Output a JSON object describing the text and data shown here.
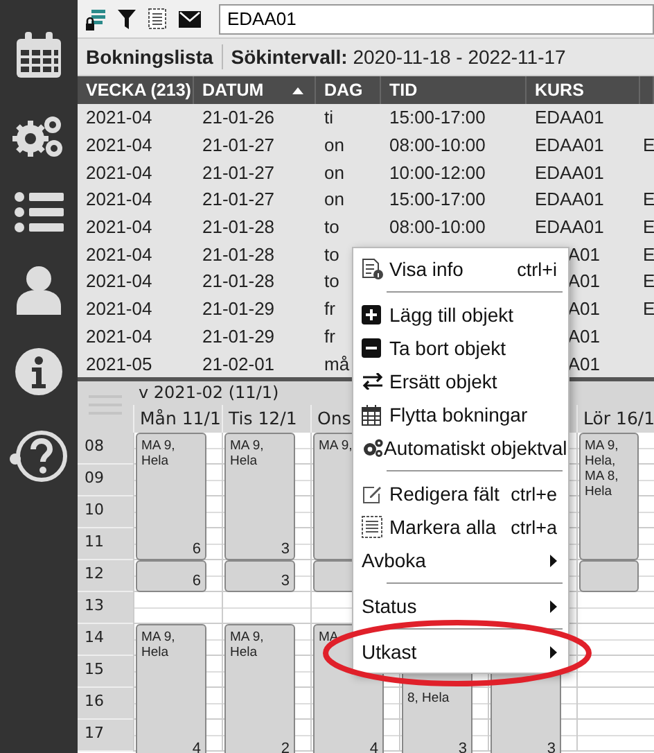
{
  "sidebar": {
    "items": [
      {
        "kind": "calendar"
      },
      {
        "kind": "settings"
      },
      {
        "kind": "list"
      },
      {
        "kind": "user"
      },
      {
        "kind": "info"
      },
      {
        "kind": "help"
      }
    ]
  },
  "toolbar": {
    "search": {
      "value": "EDAA01"
    }
  },
  "header": {
    "title": "Bokningslista",
    "interval": "**Sökintervall:** 2020-11-18 - 2022-11-17"
  },
  "table": {
    "columns": [
      {
        "label": "VECKA (213)"
      },
      {
        "label": "DATUM",
        "sorted": true
      },
      {
        "label": "DAG"
      },
      {
        "label": "TID"
      },
      {
        "label": "KURS"
      },
      {}
    ],
    "rows": [
      {
        "vecka": "2021-04",
        "datum": "21-01-26",
        "dag": "ti",
        "tid": "15:00-17:00",
        "kurs": "EDAA01"
      },
      {
        "vecka": "2021-04",
        "datum": "21-01-27",
        "dag": "on",
        "tid": "08:00-10:00",
        "kurs": "EDAA01",
        "column_6": "E"
      },
      {
        "vecka": "2021-04",
        "datum": "21-01-27",
        "dag": "on",
        "tid": "10:00-12:00",
        "kurs": "EDAA01"
      },
      {
        "vecka": "2021-04",
        "datum": "21-01-27",
        "dag": "on",
        "tid": "15:00-17:00",
        "kurs": "EDAA01",
        "column_6": "E"
      },
      {
        "vecka": "2021-04",
        "datum": "21-01-28",
        "dag": "to",
        "tid": "08:00-10:00",
        "kurs": "EDAA01",
        "column_6": "E"
      },
      {
        "vecka": "2021-04",
        "datum": "21-01-28",
        "dag": "to",
        "kurs": "A01",
        "column_6": "E"
      },
      {
        "vecka": "2021-04",
        "datum": "21-01-28",
        "dag": "to",
        "kurs": "A01",
        "column_6": "E"
      },
      {
        "vecka": "2021-04",
        "datum": "21-01-29",
        "dag": "fr",
        "kurs": "A01",
        "column_6": "E"
      },
      {
        "vecka": "2021-04",
        "datum": "21-01-29",
        "dag": "fr",
        "kurs": "A01"
      },
      {
        "vecka": "2021-05",
        "datum": "21-02-01",
        "dag": "må",
        "kurs": "A01"
      }
    ]
  },
  "calendar": {
    "week": "v 2021-02 (11/1)",
    "hours": [
      "08",
      "09",
      "10",
      "11",
      "12",
      "13",
      "14",
      "15",
      "16",
      "17"
    ],
    "days": [
      {
        "label": "Mån 11/1",
        "events": [
          {
            "kind": "morning",
            "text": "MA 9, Hela",
            "count": "6"
          },
          {
            "kind": "noon",
            "count": "6"
          },
          {
            "kind": "afternoon",
            "text": "MA 9, Hela",
            "count": "4"
          }
        ]
      },
      {
        "label": "Tis 12/1",
        "events": [
          {
            "kind": "morning",
            "text": "MA 9, Hela",
            "count": "3"
          },
          {
            "kind": "noon",
            "count": "3"
          },
          {
            "kind": "afternoon",
            "text": "MA 9, Hela",
            "count": "2"
          }
        ]
      },
      {
        "label": "Ons",
        "events": [
          {
            "kind": "morning",
            "text": "MA 9,"
          },
          {
            "kind": "noon"
          },
          {
            "kind": "afternoon",
            "text": "MA",
            "count": "4"
          }
        ]
      },
      {
        "events": [
          {
            "kind": "afternoon_continued",
            "text": "8, Hela",
            "count": "3"
          }
        ]
      },
      {
        "events": [
          {
            "kind": "afternoon",
            "count": "3"
          }
        ]
      },
      {
        "label": "Lör 16/1",
        "events": [
          {
            "kind": "morning",
            "text": "MA 9, Hela, MA 8, Hela"
          },
          {
            "kind": "noon"
          }
        ]
      }
    ]
  },
  "context_menu": {
    "items": [
      {
        "kind": "item",
        "label": "Visa info",
        "shortcut": "ctrl+i"
      },
      {
        "kind": "separator"
      },
      {
        "kind": "item",
        "label": "Lägg till objekt"
      },
      {
        "kind": "item",
        "label": "Ta bort objekt"
      },
      {
        "kind": "item",
        "label": "Ersätt objekt"
      },
      {
        "kind": "item",
        "label": "Flytta bokningar"
      },
      {
        "kind": "item",
        "label": "Automatiskt objektval"
      },
      {
        "kind": "separator"
      },
      {
        "kind": "item",
        "label": "Redigera fält",
        "shortcut": "ctrl+e"
      },
      {
        "kind": "item",
        "label": "Markera alla",
        "shortcut": "ctrl+a"
      },
      {
        "kind": "submenu",
        "label": "Avboka"
      },
      {
        "kind": "separator"
      },
      {
        "kind": "submenu",
        "label": "Status"
      },
      {
        "kind": "separator"
      },
      {
        "kind": "submenu",
        "label": "Utkast",
        "highlighted": true
      }
    ]
  }
}
